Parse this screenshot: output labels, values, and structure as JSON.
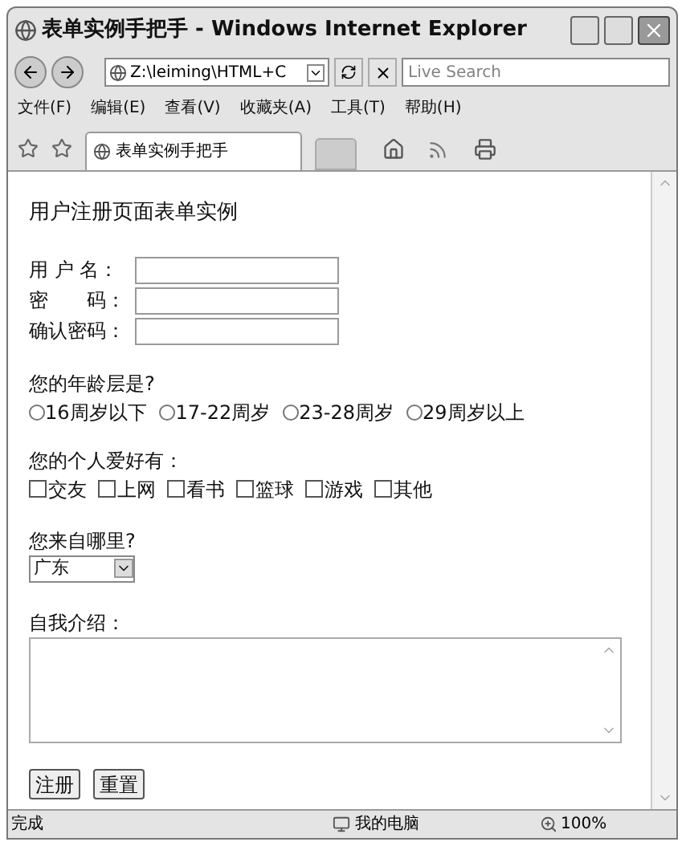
{
  "window": {
    "title": "表单实例手把手 - Windows Internet Explorer"
  },
  "address": {
    "value": "Z:\\leiming\\HTML+C"
  },
  "search": {
    "placeholder": "Live Search"
  },
  "menu": [
    "文件(F)",
    "编辑(E)",
    "查看(V)",
    "收藏夹(A)",
    "工具(T)",
    "帮助(H)"
  ],
  "tabs": [
    {
      "label": "表单实例手把手",
      "selected": true
    }
  ],
  "page": {
    "heading": "用户注册页面表单实例",
    "fields": [
      {
        "label": "用 户 名："
      },
      {
        "label": "密　　码："
      },
      {
        "label": "确认密码："
      }
    ],
    "age": {
      "question": "您的年龄层是?",
      "options": [
        {
          "label": "16周岁以下",
          "selected": false
        },
        {
          "label": "17-22周岁",
          "selected": false
        },
        {
          "label": "23-28周岁",
          "selected": false
        },
        {
          "label": "29周岁以上",
          "selected": false
        }
      ]
    },
    "hobbies": {
      "question": "您的个人爱好有：",
      "options": [
        {
          "label": "交友",
          "checked": false
        },
        {
          "label": "上网",
          "checked": false
        },
        {
          "label": "看书",
          "checked": false
        },
        {
          "label": "篮球",
          "checked": false
        },
        {
          "label": "游戏",
          "checked": false
        },
        {
          "label": "其他",
          "checked": false
        }
      ]
    },
    "origin": {
      "question": "您来自哪里?",
      "value": "广东"
    },
    "intro": {
      "label": "自我介绍："
    },
    "buttons": [
      "注册",
      "重置"
    ]
  },
  "status_bar": {
    "status": "完成",
    "zone": "我的电脑",
    "zoom": "100%"
  }
}
